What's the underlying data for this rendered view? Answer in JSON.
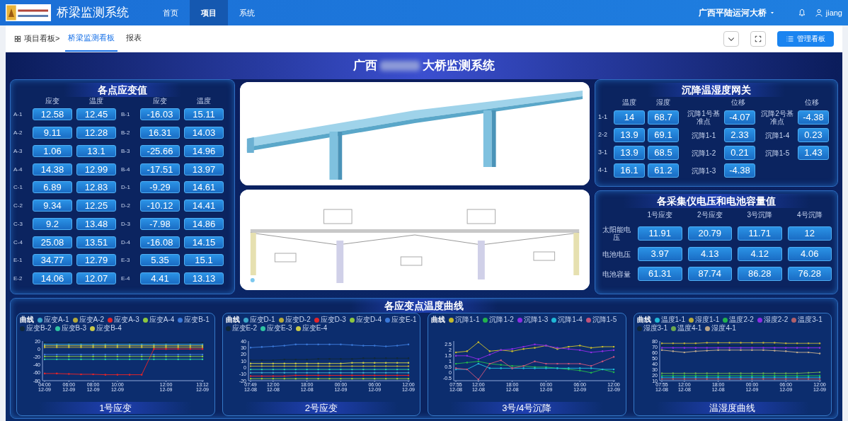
{
  "navbar": {
    "title": "桥梁监测系统",
    "menu": [
      {
        "label": "首页",
        "selected": false
      },
      {
        "label": "项目",
        "selected": true
      },
      {
        "label": "系统",
        "selected": false
      }
    ],
    "project": "广西平陆运河大桥",
    "user": "jiang"
  },
  "subbar": {
    "crumb": "项目看板>",
    "tabs": [
      {
        "label": "桥梁监测看板",
        "selected": true
      },
      {
        "label": "报表",
        "selected": false
      }
    ],
    "manage_button": "管理看板"
  },
  "dashboard": {
    "title_start": "广西",
    "title_end": "大桥监测系统"
  },
  "strain_panel": {
    "title": "各点应变值",
    "headers": [
      "应变",
      "温度",
      "应变",
      "温度"
    ],
    "groups": [
      {
        "rows": [
          {
            "left": {
              "label": "A-1",
              "strain": "12.58",
              "temp": "12.45"
            },
            "right": {
              "label": "B-1",
              "strain": "-16.03",
              "temp": "15.11"
            }
          },
          {
            "left": {
              "label": "A-2",
              "strain": "9.11",
              "temp": "12.28"
            },
            "right": {
              "label": "B-2",
              "strain": "16.31",
              "temp": "14.03"
            }
          },
          {
            "left": {
              "label": "A-3",
              "strain": "1.06",
              "temp": "13.1"
            },
            "right": {
              "label": "B-3",
              "strain": "-25.66",
              "temp": "14.96"
            }
          },
          {
            "left": {
              "label": "A-4",
              "strain": "14.38",
              "temp": "12.99"
            },
            "right": {
              "label": "B-4",
              "strain": "-17.51",
              "temp": "13.97"
            }
          }
        ]
      },
      {
        "rows": [
          {
            "left": {
              "label": "C-1",
              "strain": "6.89",
              "temp": "12.83"
            },
            "right": {
              "label": "D-1",
              "strain": "-9.29",
              "temp": "14.61"
            }
          },
          {
            "left": {
              "label": "C-2",
              "strain": "9.34",
              "temp": "12.25"
            },
            "right": {
              "label": "D-2",
              "strain": "-10.12",
              "temp": "14.41"
            }
          },
          {
            "left": {
              "label": "C-3",
              "strain": "9.2",
              "temp": "13.48"
            },
            "right": {
              "label": "D-3",
              "strain": "-7.98",
              "temp": "14.86"
            }
          },
          {
            "left": {
              "label": "C-4",
              "strain": "25.08",
              "temp": "13.51"
            },
            "right": {
              "label": "D-4",
              "strain": "-16.08",
              "temp": "14.15"
            }
          }
        ]
      },
      {
        "rows": [
          {
            "left": {
              "label": "E-1",
              "strain": "34.77",
              "temp": "12.79"
            },
            "right": {
              "label": "E-3",
              "strain": "5.35",
              "temp": "15.1"
            }
          },
          {
            "left": {
              "label": "E-2",
              "strain": "14.06",
              "temp": "12.07"
            },
            "right": {
              "label": "E-4",
              "strain": "4.41",
              "temp": "13.13"
            }
          }
        ]
      }
    ]
  },
  "gateway_panel": {
    "title": "沉降温湿度网关",
    "headers": [
      "温度",
      "湿度"
    ],
    "rows": [
      {
        "label": "1-1",
        "temp": "14",
        "humidity": "68.7"
      },
      {
        "label": "2-2",
        "temp": "13.9",
        "humidity": "69.1"
      },
      {
        "label": "3-1",
        "temp": "13.9",
        "humidity": "68.5"
      },
      {
        "label": "4-1",
        "temp": "16.1",
        "humidity": "61.2"
      }
    ],
    "displacement": [
      {
        "header": "位移",
        "items": [
          {
            "label": "沉降1号基准点",
            "value": "-4.07"
          },
          {
            "label": "沉降1-1",
            "value": "2.33"
          },
          {
            "label": "沉降1-2",
            "value": "0.21"
          },
          {
            "label": "沉降1-3",
            "value": "-4.38"
          }
        ]
      },
      {
        "header": "位移",
        "items": [
          {
            "label": "沉降2号基准点",
            "value": "-4.38"
          },
          {
            "label": "沉降1-4",
            "value": "0.23"
          },
          {
            "label": "沉降1-5",
            "value": "1.43"
          }
        ]
      }
    ]
  },
  "power_panel": {
    "title": "各采集仪电压和电池容量值",
    "columns": [
      "1号应变",
      "2号应变",
      "3号沉降",
      "4号沉降"
    ],
    "rows": [
      {
        "label": "太阳能电压",
        "values": [
          "11.91",
          "20.79",
          "11.71",
          "12"
        ]
      },
      {
        "label": "电池电压",
        "values": [
          "3.97",
          "4.13",
          "4.12",
          "4.06"
        ]
      },
      {
        "label": "电池容量",
        "values": [
          "61.31",
          "87.74",
          "86.28",
          "76.28"
        ]
      }
    ]
  },
  "curves_section": {
    "title": "各应变点温度曲线",
    "charts": [
      {
        "legend_title": "曲线",
        "title": "1号应变",
        "chart_data": {
          "type": "line",
          "categories": [
            "04:00 12-09",
            null,
            "06:00 12-09",
            null,
            "08:00 12-09",
            null,
            "10:00 12-09",
            null,
            null,
            null,
            "12:00 12-09",
            null,
            null,
            "13:12 12-09"
          ],
          "ylim": [
            -80,
            20
          ],
          "yticks": [
            -80,
            -60,
            -40,
            -20,
            0,
            20
          ],
          "series": [
            {
              "name": "应变A-1",
              "color": "#3ba6c9",
              "values": [
                12,
                12,
                12,
                12,
                12,
                12,
                12,
                12,
                12,
                12,
                12,
                12,
                12,
                12
              ]
            },
            {
              "name": "应变A-2",
              "color": "#b5a93a",
              "values": [
                4,
                4,
                4,
                4,
                4,
                4,
                4,
                4,
                4,
                4,
                4,
                4,
                4,
                4
              ]
            },
            {
              "name": "应变A-3",
              "color": "#e0242a",
              "values": [
                -62,
                -62,
                -63,
                -64,
                -64,
                -65,
                -65,
                -65,
                -65,
                0,
                0,
                0,
                0,
                0
              ]
            },
            {
              "name": "应变A-4",
              "color": "#8cc63f",
              "values": [
                -19,
                -19,
                -19,
                -19,
                -19,
                -19,
                -19,
                -19,
                -19,
                -19,
                -19,
                -19,
                -19,
                -19
              ]
            },
            {
              "name": "应变B-1",
              "color": "#3a78d8",
              "values": [
                -14,
                -14,
                -14,
                -14,
                -14,
                -14,
                -14,
                -14,
                -14,
                -14,
                -14,
                -14,
                -14,
                -14
              ]
            },
            {
              "name": "应变B-2",
              "color": "#10283a",
              "values": [
                16,
                16,
                16,
                16,
                16,
                16,
                16,
                16,
                16,
                16,
                16,
                16,
                16,
                16
              ]
            },
            {
              "name": "应变B-3",
              "color": "#2fc4a2",
              "values": [
                -26,
                -26,
                -26,
                -26,
                -26,
                -26,
                -26,
                -26,
                -26,
                -26,
                -26,
                -26,
                -26,
                -26
              ]
            },
            {
              "name": "应变B-4",
              "color": "#c9c94a",
              "values": [
                8,
                8,
                8,
                8,
                8,
                8,
                8,
                8,
                8,
                8,
                8,
                8,
                8,
                8
              ]
            }
          ]
        }
      },
      {
        "legend_title": "曲线",
        "title": "2号应变",
        "chart_data": {
          "type": "line",
          "categories": [
            "07:49 12-08",
            null,
            "12:00 12-08",
            null,
            null,
            "18:00 12-08",
            null,
            null,
            "00:00 12-09",
            null,
            null,
            "06:00 12-09",
            null,
            null,
            "12:00 12-09"
          ],
          "ylim": [
            -20,
            40
          ],
          "yticks": [
            -20,
            -10,
            0,
            10,
            20,
            30,
            40
          ],
          "series": [
            {
              "name": "应变D-1",
              "color": "#3ba6c9",
              "values": [
                -8,
                -8,
                -8,
                -8,
                -8,
                -8,
                -8,
                -8,
                -8,
                -8,
                -8,
                -8,
                -8,
                -8,
                -8
              ]
            },
            {
              "name": "应变D-2",
              "color": "#b5a93a",
              "values": [
                2,
                2,
                2,
                2,
                2,
                2,
                2,
                2,
                2,
                2,
                2,
                2,
                2,
                2,
                2
              ]
            },
            {
              "name": "应变D-3",
              "color": "#e0242a",
              "values": [
                -13,
                -13,
                -13,
                -13,
                -12,
                -12,
                -12,
                -12,
                -12,
                -12,
                -12,
                -12,
                -12,
                -12,
                -12
              ]
            },
            {
              "name": "应变D-4",
              "color": "#8cc63f",
              "values": [
                -17,
                -17,
                -17,
                -17,
                -17,
                -17,
                -17,
                -17,
                -17,
                -17,
                -17,
                -17,
                -17,
                -17,
                -17
              ]
            },
            {
              "name": "应变E-1",
              "color": "#3a78d8",
              "values": [
                30,
                31,
                32,
                33,
                35,
                35,
                35,
                35,
                35,
                34,
                33,
                33,
                32,
                33,
                35
              ]
            },
            {
              "name": "应变E-2",
              "color": "#10283a",
              "values": [
                11,
                11,
                11,
                12,
                12,
                12,
                13,
                13,
                13,
                13,
                14,
                14,
                14,
                14,
                14
              ]
            },
            {
              "name": "应变E-3",
              "color": "#2fc4a2",
              "values": [
                -3,
                -3,
                -3,
                -3,
                -3,
                -3,
                -3,
                -3,
                -3,
                -3,
                -3,
                -3,
                -3,
                -3,
                -3
              ]
            },
            {
              "name": "应变E-4",
              "color": "#c9c94a",
              "values": [
                6,
                6,
                6,
                6,
                6,
                6,
                6,
                6,
                6,
                7,
                7,
                7,
                7,
                7,
                7
              ]
            }
          ]
        }
      },
      {
        "legend_title": "曲线",
        "title": "3号/4号沉降",
        "chart_data": {
          "type": "line",
          "categories": [
            "07:55 12-08",
            null,
            "12:00 12-08",
            null,
            null,
            "18:00 12-08",
            null,
            null,
            "00:00 12-09",
            null,
            null,
            "06:00 12-09",
            null,
            null,
            "12:00 12-09"
          ],
          "ylim": [
            -0.7,
            2.8
          ],
          "yticks": [
            -0.5,
            0,
            0.5,
            1,
            1.5,
            2,
            2.5
          ],
          "series": [
            {
              "name": "沉降1-1",
              "color": "#c2b82e",
              "values": [
                1.8,
                1.9,
                2.7,
                1.9,
                2.0,
                1.9,
                2.1,
                2.2,
                2.4,
                2.1,
                2.3,
                2.4,
                2.2,
                2.3,
                2.3
              ]
            },
            {
              "name": "沉降1-2",
              "color": "#22b24c",
              "values": [
                0.8,
                0.9,
                1.0,
                0.8,
                0.7,
                0.6,
                0.6,
                0.5,
                0.5,
                0.4,
                0.3,
                0.2,
                0.0,
                0.3,
                0.05
              ]
            },
            {
              "name": "沉降1-3",
              "color": "#8a2be2",
              "values": [
                1.5,
                1.5,
                1.2,
                1.6,
                2.0,
                2.1,
                2.3,
                2.5,
                2.4,
                2.2,
                2.1,
                2.0,
                1.8,
                1.9,
                2.0
              ]
            },
            {
              "name": "沉降1-4",
              "color": "#1fb8d6",
              "values": [
                0.3,
                0.3,
                0.8,
                0.4,
                0.4,
                0.4,
                0.4,
                0.4,
                0.4,
                0.4,
                0.4,
                0.4,
                0.4,
                0.3,
                0.3
              ]
            },
            {
              "name": "沉降1-5",
              "color": "#c2527a",
              "values": [
                0.4,
                0.3,
                -0.6,
                0.8,
                1.1,
                0.4,
                0.6,
                1.0,
                0.8,
                0.8,
                0.8,
                0.8,
                0.6,
                1.0,
                1.4
              ]
            }
          ]
        }
      },
      {
        "legend_title": "曲线",
        "title": "温湿度曲线",
        "chart_data": {
          "type": "line",
          "categories": [
            "07:55 12-08",
            null,
            "12:00 12-08",
            null,
            null,
            "18:00 12-08",
            null,
            null,
            "00:00 12-09",
            null,
            null,
            "06:00 12-09",
            null,
            null,
            "12:00 12-09"
          ],
          "ylim": [
            10,
            80
          ],
          "yticks": [
            10,
            20,
            30,
            40,
            50,
            60,
            70,
            80
          ],
          "series": [
            {
              "name": "温度1-1",
              "color": "#1fb8d6",
              "values": [
                16,
                16,
                16,
                16,
                16,
                16,
                16,
                16,
                16,
                16,
                16,
                16,
                16,
                16,
                16
              ]
            },
            {
              "name": "湿度1-1",
              "color": "#b5a93a",
              "values": [
                76,
                76,
                76,
                76,
                77,
                77,
                77,
                77,
                77,
                77,
                77,
                76,
                76,
                76,
                76
              ]
            },
            {
              "name": "温度2-2",
              "color": "#22b24c",
              "values": [
                19,
                19,
                19,
                19,
                19,
                19,
                19,
                19,
                19,
                19,
                19,
                19,
                19,
                19,
                19
              ]
            },
            {
              "name": "湿度2-2",
              "color": "#8a2be2",
              "values": [
                68,
                68,
                68,
                68,
                68,
                68,
                68,
                68,
                68,
                68,
                68,
                68,
                68,
                68,
                68
              ]
            },
            {
              "name": "温度3-1",
              "color": "#b0606a",
              "values": [
                13,
                13,
                13,
                13,
                13,
                13,
                13,
                13,
                13,
                13,
                13,
                13,
                13,
                13,
                13
              ]
            },
            {
              "name": "湿度3-1",
              "color": "#10283a",
              "values": [
                72,
                72,
                72,
                72,
                72,
                72,
                72,
                72,
                72,
                72,
                72,
                72,
                72,
                72,
                72
              ]
            },
            {
              "name": "温度4-1",
              "color": "#6aa84f",
              "values": [
                23,
                23,
                23,
                23,
                23,
                23,
                23,
                23,
                23,
                23,
                23,
                23,
                23,
                24,
                25
              ]
            },
            {
              "name": "湿度4-1",
              "color": "#b8a48a",
              "values": [
                64,
                62,
                60,
                62,
                63,
                64,
                64,
                64,
                64,
                64,
                63,
                62,
                60,
                60,
                58
              ]
            }
          ]
        }
      }
    ]
  }
}
